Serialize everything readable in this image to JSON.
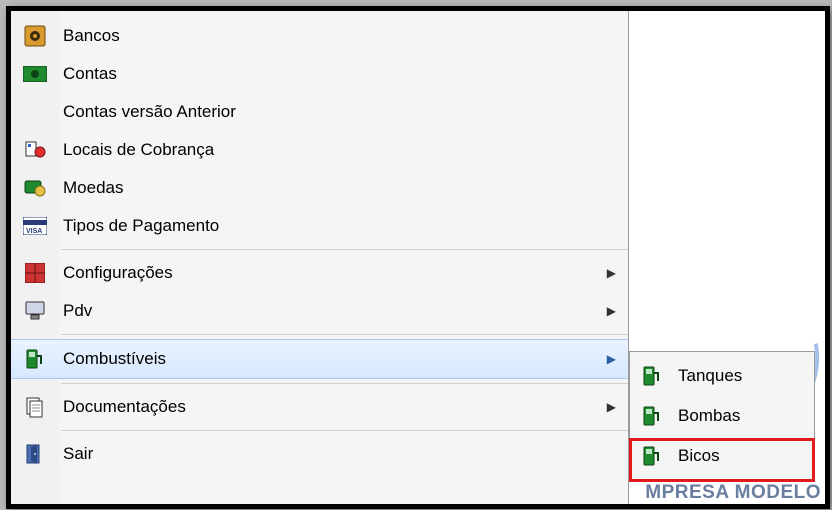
{
  "menu": {
    "items": [
      {
        "label": "Bancos",
        "icon": "camera-icon",
        "arrow": false
      },
      {
        "label": "Contas",
        "icon": "money-icon",
        "arrow": false
      },
      {
        "label": "Contas versão Anterior",
        "icon": "blank-icon",
        "arrow": false
      },
      {
        "label": "Locais de Cobrança",
        "icon": "billing-icon",
        "arrow": false
      },
      {
        "label": "Moedas",
        "icon": "coins-icon",
        "arrow": false
      },
      {
        "label": "Tipos de Pagamento",
        "icon": "card-icon",
        "arrow": false
      }
    ],
    "items2": [
      {
        "label": "Configurações",
        "icon": "grid-icon",
        "arrow": true
      },
      {
        "label": "Pdv",
        "icon": "terminal-icon",
        "arrow": true
      }
    ],
    "items3": [
      {
        "label": "Combustíveis",
        "icon": "pump-icon",
        "arrow": true,
        "hover": true
      }
    ],
    "items4": [
      {
        "label": "Documentações",
        "icon": "docs-icon",
        "arrow": true
      }
    ],
    "items5": [
      {
        "label": "Sair",
        "icon": "exit-icon",
        "arrow": false
      }
    ]
  },
  "submenu": {
    "items": [
      {
        "label": "Tanques",
        "icon": "pump-icon"
      },
      {
        "label": "Bombas",
        "icon": "pump-icon"
      },
      {
        "label": "Bicos",
        "icon": "pump-icon",
        "highlight": true
      }
    ]
  },
  "background": {
    "partial_text": "MPRESA MODELO"
  },
  "icons": {
    "camera-icon": "📷",
    "money-icon": "💵",
    "blank-icon": "",
    "billing-icon": "🧾",
    "coins-icon": "💰",
    "card-icon": "💳",
    "grid-icon": "🗂",
    "terminal-icon": "🖥",
    "pump-icon": "⛽",
    "docs-icon": "📄",
    "exit-icon": "🚪"
  }
}
